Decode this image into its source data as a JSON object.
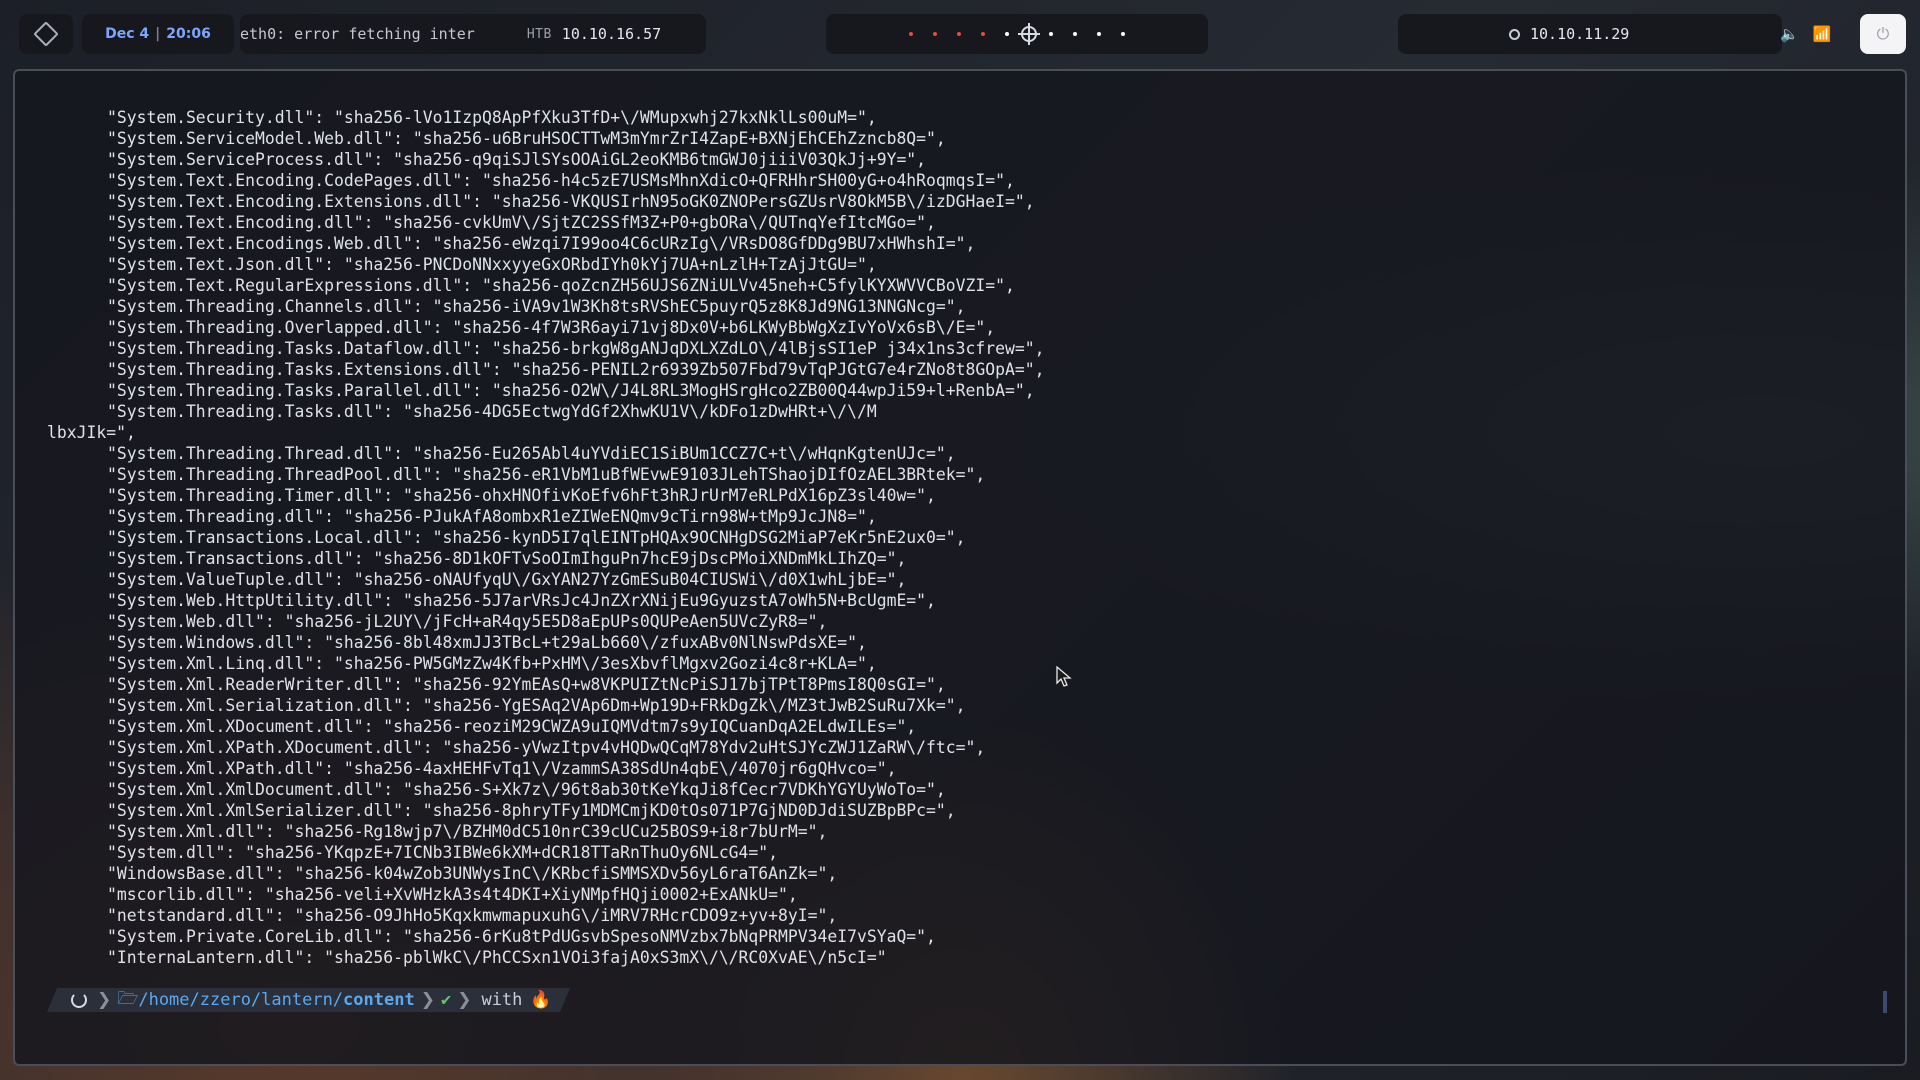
{
  "topbar": {
    "date": "Dec 4",
    "time": "20:06",
    "eth_status": "eth0: error fetching inter",
    "htb_label": "HTB",
    "htb_ip": "10.10.16.57",
    "vpn_ip": "10.10.11.29",
    "workspace_colors": [
      "#e74c3c",
      "#e74c3c",
      "#e74c3c",
      "#e74c3c",
      "#ffffff",
      "#ffffff",
      "#ffffff",
      "#ffffff",
      "#ffffff"
    ]
  },
  "terminal": {
    "lines": [
      "\"System.Security.dll\": \"sha256-lVo1IzpQ8ApPfXku3TfD+\\/WMupxwhj27kxNklLs00uM=\",",
      "\"System.ServiceModel.Web.dll\": \"sha256-u6BruHSOCTTwM3mYmrZrI4ZapE+BXNjEhCEhZzncb8Q=\",",
      "\"System.ServiceProcess.dll\": \"sha256-q9qiSJlSYsOOAiGL2eoKMB6tmGWJ0jiiiV03QkJj+9Y=\",",
      "\"System.Text.Encoding.CodePages.dll\": \"sha256-h4c5zE7USMsMhnXdicO+QFRHhrSH00yG+o4hRoqmqsI=\",",
      "\"System.Text.Encoding.Extensions.dll\": \"sha256-VKQUSIrhN95oGK0ZNOPersGZUsrV8OkM5B\\/izDGHaeI=\",",
      "\"System.Text.Encoding.dll\": \"sha256-cvkUmV\\/SjtZC2SSfM3Z+P0+gbORa\\/QUTnqYefItcMGo=\",",
      "\"System.Text.Encodings.Web.dll\": \"sha256-eWzqi7I99oo4C6cURzIg\\/VRsDO8GfDDg9BU7xHWhshI=\",",
      "\"System.Text.Json.dll\": \"sha256-PNCDoNNxxyyeGxORbdIYh0kYj7UA+nLzlH+TzAjJtGU=\",",
      "\"System.Text.RegularExpressions.dll\": \"sha256-qoZcnZH56UJS6ZNiULVv45neh+C5fylKYXWVVCBoVZI=\",",
      "\"System.Threading.Channels.dll\": \"sha256-iVA9v1W3Kh8tsRVShEC5puyrQ5z8K8Jd9NG13NNGNcg=\",",
      "\"System.Threading.Overlapped.dll\": \"sha256-4f7W3R6ayi71vj8Dx0V+b6LKWyBbWgXzIvYoVx6sB\\/E=\",",
      "\"System.Threading.Tasks.Dataflow.dll\": \"sha256-brkgW8gANJqDXLXZdLO\\/4lBjsSI1eP j34x1ns3cfrew=\",",
      "\"System.Threading.Tasks.Extensions.dll\": \"sha256-PENIL2r6939Zb507Fbd79vTqPJGtG7e4rZNo8t8GOpA=\",",
      "\"System.Threading.Tasks.Parallel.dll\": \"sha256-O2W\\/J4L8RL3MogHSrgHco2ZB00Q44wpJi59+l+RenbA=\",",
      "\"System.Threading.Tasks.dll\": \"sha256-4DG5EctwgYdGf2XhwKU1V\\/kDFo1zDwHRt+\\/\\/M",
      "lbxJIk=\",",
      "\"System.Threading.Thread.dll\": \"sha256-Eu265Abl4uYVdiEC1SiBUm1CCZ7C+t\\/wHqnKgtenUJc=\",",
      "\"System.Threading.ThreadPool.dll\": \"sha256-eR1VbM1uBfWEvwE9103JLehTShaojDIfOzAEL3BRtek=\",",
      "\"System.Threading.Timer.dll\": \"sha256-ohxHNOfivKoEfv6hFt3hRJrUrM7eRLPdX16pZ3sl40w=\",",
      "\"System.Threading.dll\": \"sha256-PJukAfA8ombxR1eZIWeENQmv9cTirn98W+tMp9JcJN8=\",",
      "\"System.Transactions.Local.dll\": \"sha256-kynD5I7qlEINTpHQAx9OCNHgDSG2MiaP7eKr5nE2ux0=\",",
      "\"System.Transactions.dll\": \"sha256-8D1kOFTvSoOImIhguPn7hcE9jDscPMoiXNDmMkLIhZQ=\",",
      "\"System.ValueTuple.dll\": \"sha256-oNAUfyqU\\/GxYAN27YzGmESuB04CIUSWi\\/d0X1whLjbE=\",",
      "\"System.Web.HttpUtility.dll\": \"sha256-5J7arVRsJc4JnZXrXNijEu9GyuzstA7oWh5N+BcUgmE=\",",
      "\"System.Web.dll\": \"sha256-jL2UY\\/jFcH+aR4qy5E5D8aEpUPs0QUPeAen5UVcZyR8=\",",
      "\"System.Windows.dll\": \"sha256-8bl48xmJJ3TBcL+t29aLb660\\/zfuxABv0NlNswPdsXE=\",",
      "\"System.Xml.Linq.dll\": \"sha256-PW5GMzZw4Kfb+PxHM\\/3esXbvflMgxv2Gozi4c8r+KLA=\",",
      "\"System.Xml.ReaderWriter.dll\": \"sha256-92YmEAsQ+w8VKPUIZtNcPiSJ17bjTPtT8PmsI8Q0sGI=\",",
      "\"System.Xml.Serialization.dll\": \"sha256-YgESAq2VAp6Dm+Wp19D+FRkDgZk\\/MZ3tJwB2SuRu7Xk=\",",
      "\"System.Xml.XDocument.dll\": \"sha256-reoziM29CWZA9uIQMVdtm7s9yIQCuanDqA2ELdwILEs=\",",
      "\"System.Xml.XPath.XDocument.dll\": \"sha256-yVwzItpv4vHQDwQCqM78Ydv2uHtSJYcZWJ1ZaRW\\/ftc=\",",
      "\"System.Xml.XPath.dll\": \"sha256-4axHEHFvTq1\\/VzammSA38SdUn4qbE\\/4070jr6gQHvco=\",",
      "\"System.Xml.XmlDocument.dll\": \"sha256-S+Xk7z\\/96t8ab30tKeYkqJi8fCecr7VDKhYGYUyWoTo=\",",
      "\"System.Xml.XmlSerializer.dll\": \"sha256-8phryTFy1MDMCmjKD0tOs071P7GjND0DJdiSUZBpBPc=\",",
      "\"System.Xml.dll\": \"sha256-Rg18wjp7\\/BZHM0dC510nrC39cUCu25BOS9+i8r7bUrM=\",",
      "\"System.dll\": \"sha256-YKqpzE+7ICNb3IBWe6kXM+dCR18TTaRnThuOy6NLcG4=\",",
      "\"WindowsBase.dll\": \"sha256-k04wZob3UNWysInC\\/KRbcfiSMMSXDv56yL6raT6AnZk=\",",
      "\"mscorlib.dll\": \"sha256-veli+XvWHzkA3s4t4DKI+XiyNMpfHQji0002+ExANkU=\",",
      "\"netstandard.dll\": \"sha256-O9JhHo5KqxkmwmapuxuhG\\/iMRV7RHcrCDO9z+yv+8yI=\",",
      "\"System.Private.CoreLib.dll\": \"sha256-6rKu8tPdUGsvbSpesoNMVzbx7bNqPRMPV34eI7vSYaQ=\",",
      "\"InternaLantern.dll\": \"sha256-pblWkC\\/PhCCSxn1VOi3fajA0xS3mX\\/\\/RC0XvAE\\/n5cI=\""
    ],
    "wrap_index": 15
  },
  "prompt": {
    "dir_prefix": "/home/zzero/lantern/",
    "dir_last": "content",
    "status_glyph": "✔",
    "with_text": "with",
    "flame_glyph": "🔥"
  },
  "icons": {
    "menu": "cube-icon",
    "vpn": "crosshair-icon",
    "volume": "volume-icon",
    "wifi": "wifi-icon",
    "power": "power-icon",
    "folder": "folder-icon",
    "spinner": "spinner-icon"
  }
}
